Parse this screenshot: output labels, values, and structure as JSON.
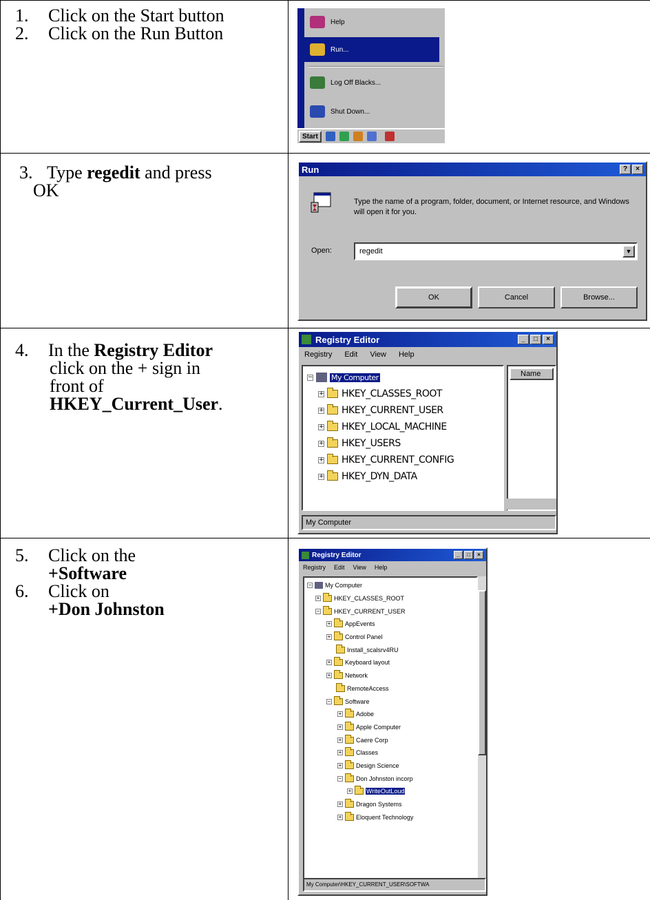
{
  "steps": {
    "s1": {
      "num": "1.",
      "text": "Click on the Start button"
    },
    "s2": {
      "num": "2.",
      "text": "Click on the Run Button"
    },
    "s3": {
      "num": "3.",
      "pre": "Type ",
      "bold": "regedit",
      "post": " and press",
      "cont": "OK"
    },
    "s4": {
      "num": "4.",
      "pre": "In the ",
      "bold": "Registry Editor",
      "l2": "click on the + sign in",
      "l3": "front of",
      "bold2": "HKEY_Current_User",
      "end": "."
    },
    "s5": {
      "num": "5.",
      "text": "Click on the",
      "bold": "+Software"
    },
    "s6": {
      "num": "6.",
      "text": "Click on",
      "bold": "+Don Johnston"
    }
  },
  "start_menu": {
    "items": [
      "Help",
      "Run...",
      "Log Off Blacks...",
      "Shut Down..."
    ],
    "start_label": "Start"
  },
  "run_dialog": {
    "title": "Run",
    "help_btn": "?",
    "close_btn": "×",
    "description": "Type the name of a program, folder, document, or Internet resource, and Windows will open it for you.",
    "open_label": "Open:",
    "open_value": "regedit",
    "ok": "OK",
    "cancel": "Cancel",
    "browse": "Browse..."
  },
  "registry1": {
    "title": "Registry Editor",
    "menu": [
      "Registry",
      "Edit",
      "View",
      "Help"
    ],
    "root": "My Computer",
    "keys": [
      "HKEY_CLASSES_ROOT",
      "HKEY_CURRENT_USER",
      "HKEY_LOCAL_MACHINE",
      "HKEY_USERS",
      "HKEY_CURRENT_CONFIG",
      "HKEY_DYN_DATA"
    ],
    "name_col": "Name",
    "status": "My Computer"
  },
  "registry2": {
    "title": "Registry Editor",
    "menu": [
      "Registry",
      "Edit",
      "View",
      "Help"
    ],
    "nodes": [
      "My Computer",
      "HKEY_CLASSES_ROOT",
      "HKEY_CURRENT_USER",
      "AppEvents",
      "Control Panel",
      "Install_scalsrv4RU",
      "Keyboard layout",
      "Network",
      "RemoteAccess",
      "Software",
      "Adobe",
      "Apple Computer",
      "Caere Corp",
      "Classes",
      "Design Science",
      "Don Johnston incorp",
      "WriteOutLoud",
      "Dragon Systems",
      "Eloquent Technology"
    ],
    "status": "My Computer\\HKEY_CURRENT_USER\\SOFTWA"
  }
}
